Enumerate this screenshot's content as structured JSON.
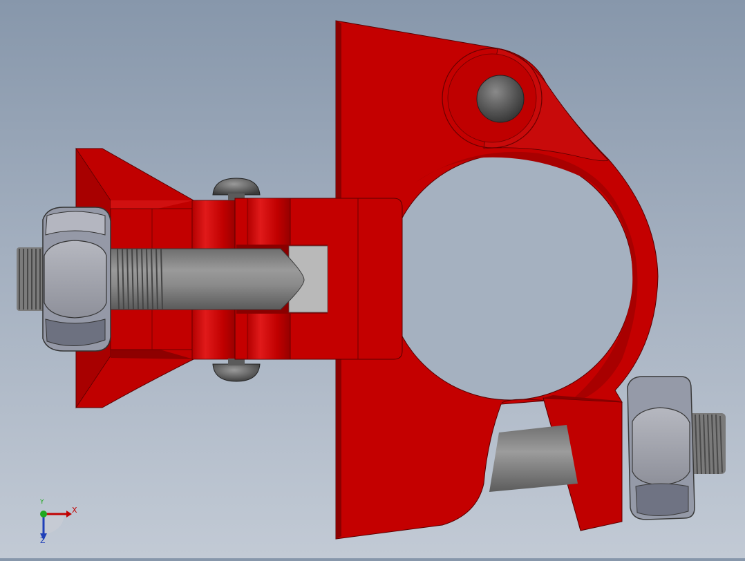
{
  "viewport": {
    "background_top": "#8797ab",
    "background_bottom": "#c2cad5"
  },
  "model": {
    "part_color": "#c00000",
    "part_dark": "#8e0000",
    "part_light": "#d81a1a",
    "steel_color": "#8c8c8c",
    "nut_color": "#9a9ca6"
  },
  "triad": {
    "x_label": "X",
    "y_label": "Y",
    "z_label": "Z",
    "x_color": "#c00000",
    "y_color": "#1fa81f",
    "z_color": "#1f3fb8"
  }
}
